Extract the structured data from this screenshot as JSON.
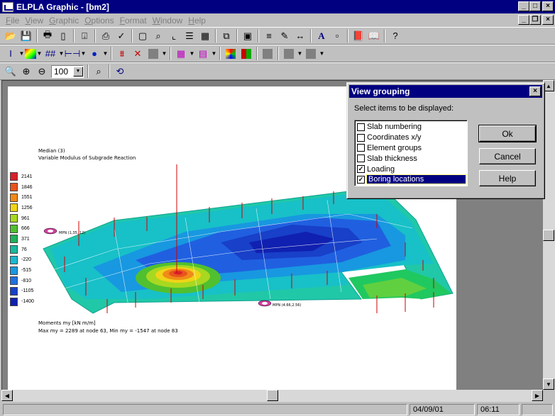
{
  "window": {
    "title": "ELPLA Graphic - [bm2]"
  },
  "menu": [
    "File",
    "View",
    "Graphic",
    "Options",
    "Format",
    "Window",
    "Help"
  ],
  "toolbar": {
    "zoom_value": "100"
  },
  "plot": {
    "heading_line1": "Median (3)",
    "heading_line2": "Variable Modulus of Subgrade Reaction",
    "footer_line1": "Moments my [kN m/m]",
    "footer_line2": "Max  my = 2289 at node 63, Min  my = -1547 at node 83",
    "boring1_label": "MPN (1,35, 12)",
    "boring2_label": "MPN (4.66,2.56)",
    "legend": [
      {
        "value": "2141",
        "color": "#d8202a"
      },
      {
        "value": "1846",
        "color": "#e8541c"
      },
      {
        "value": "1551",
        "color": "#f08a18"
      },
      {
        "value": "1256",
        "color": "#f0d418"
      },
      {
        "value": "961",
        "color": "#a8d820"
      },
      {
        "value": "666",
        "color": "#50c030"
      },
      {
        "value": "371",
        "color": "#20b058"
      },
      {
        "value": "76",
        "color": "#18b8a0"
      },
      {
        "value": "-220",
        "color": "#18b8d0"
      },
      {
        "value": "-515",
        "color": "#1898e0"
      },
      {
        "value": "-810",
        "color": "#2070e0"
      },
      {
        "value": "-1105",
        "color": "#1840c8"
      },
      {
        "value": "-1400",
        "color": "#1020b0"
      }
    ]
  },
  "dialog": {
    "title": "View grouping",
    "prompt": "Select items to be displayed:",
    "items": [
      {
        "label": "Slab numbering",
        "checked": false
      },
      {
        "label": "Coordinates x/y",
        "checked": false
      },
      {
        "label": "Element groups",
        "checked": false
      },
      {
        "label": "Slab thickness",
        "checked": false
      },
      {
        "label": "Loading",
        "checked": true
      },
      {
        "label": "Boring locations",
        "checked": true
      }
    ],
    "ok": "Ok",
    "cancel": "Cancel",
    "help": "Help"
  },
  "status": {
    "date": "04/09/01",
    "time": "06:11"
  }
}
